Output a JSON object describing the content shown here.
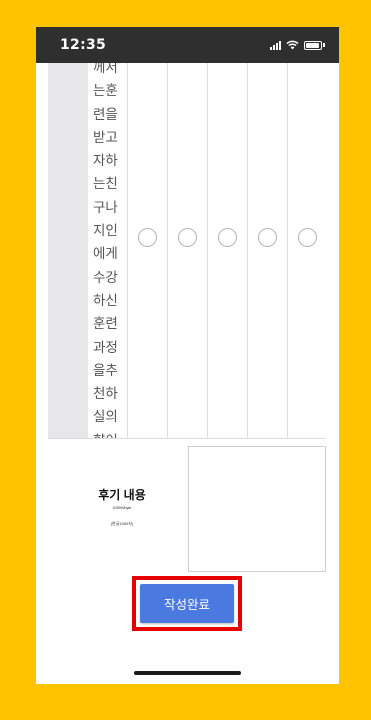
{
  "status_bar": {
    "time": "12:35",
    "icons": [
      "cellular-signal-icon",
      "wifi-icon",
      "battery-icon"
    ]
  },
  "survey": {
    "question_text": "께서는훈련을받고자하는친구나지인에게수강하신훈련과정을추천하실의향이어느정도있으십니까?",
    "rating_options": [
      {
        "selected": false
      },
      {
        "selected": false
      },
      {
        "selected": false
      },
      {
        "selected": false
      },
      {
        "selected": false
      }
    ]
  },
  "review": {
    "label": "후기 내용",
    "byte_counter": "0/3000byte",
    "char_limit": "(한글1000자)",
    "textarea_value": ""
  },
  "submit": {
    "label": "작성완료"
  },
  "colors": {
    "page_background": "#FFC300",
    "status_bar": "#2f2f2f",
    "submit_button": "#4a79e0",
    "highlight_border": "#e60000"
  }
}
